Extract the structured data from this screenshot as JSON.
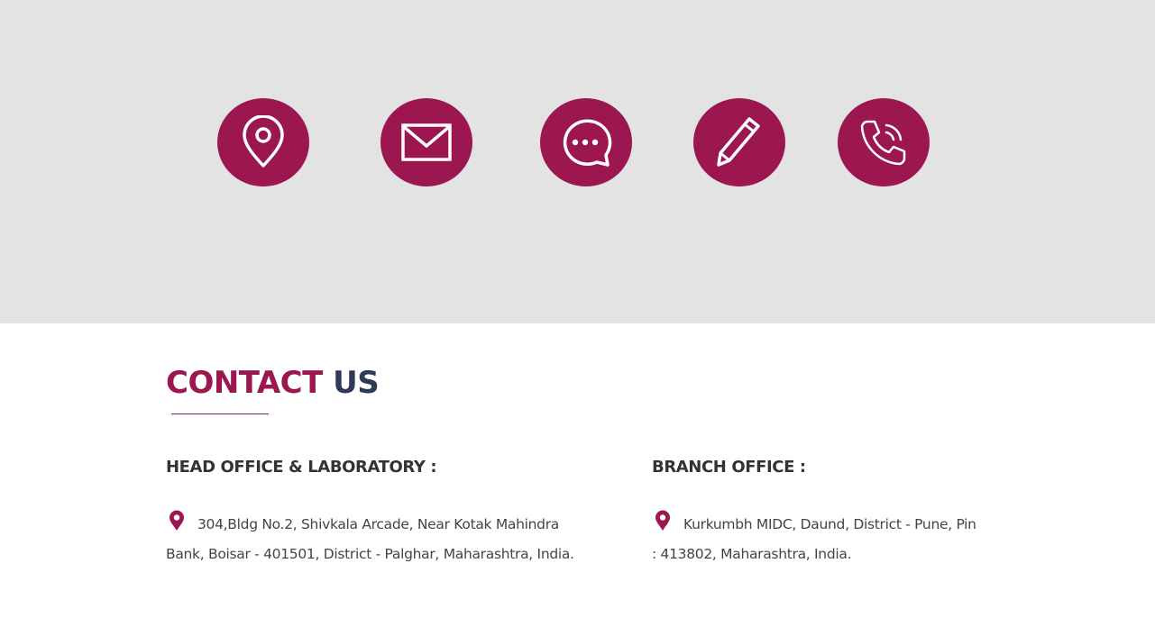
{
  "contact_icons": [
    {
      "name": "location-pin-icon"
    },
    {
      "name": "envelope-icon"
    },
    {
      "name": "chat-bubble-icon"
    },
    {
      "name": "pencil-icon"
    },
    {
      "name": "phone-icon"
    }
  ],
  "section": {
    "title_part1": "CONTACT",
    "title_part2": "US"
  },
  "head_office": {
    "heading": "HEAD OFFICE & LABORATORY :",
    "address": "304,Bldg No.2, Shivkala Arcade, Near Kotak Mahindra Bank, Boisar - 401501, District - Palghar, Maharashtra, India."
  },
  "branch_office": {
    "heading": "BRANCH OFFICE :",
    "address": "Kurkumbh MIDC, Daund, District - Pune, Pin : 413802, Maharashtra, India."
  },
  "colors": {
    "accent": "#9c174f",
    "title_dark": "#2e3a57",
    "hero_bg": "#e3e3e3"
  }
}
